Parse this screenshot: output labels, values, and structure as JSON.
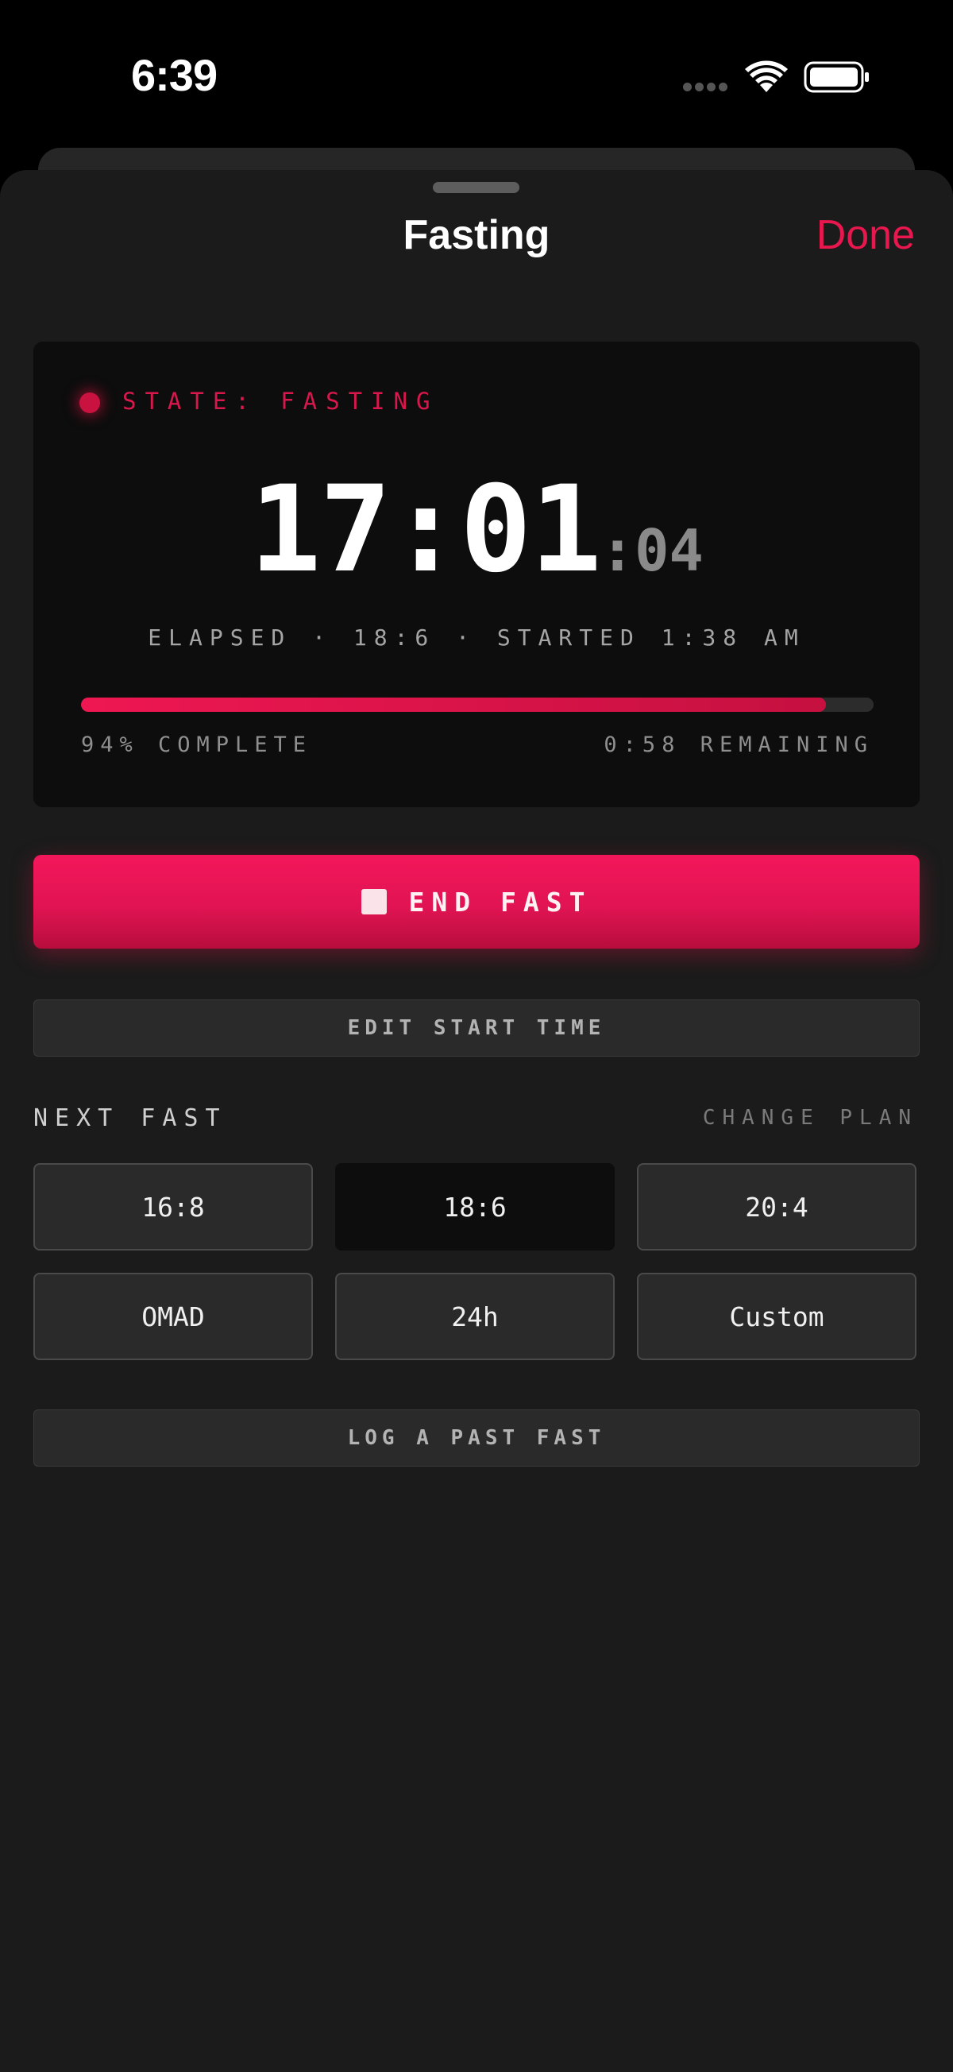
{
  "status_bar": {
    "time": "6:39"
  },
  "sheet": {
    "title": "Fasting",
    "done_label": "Done"
  },
  "timer_card": {
    "state_label": "STATE: FASTING",
    "timer_main": "17:01",
    "timer_seconds": ":04",
    "elapsed_line": "ELAPSED · 18:6 · STARTED 1:38 AM",
    "progress_fraction": 0.94,
    "progress_label": "94% COMPLETE",
    "remaining_label": "0:58 REMAINING"
  },
  "actions": {
    "end_fast_label": "END FAST",
    "edit_start_label": "EDIT START TIME",
    "log_past_label": "LOG A PAST FAST"
  },
  "next_fast": {
    "label": "NEXT FAST",
    "change_plan_label": "CHANGE PLAN",
    "plans": [
      {
        "label": "16:8",
        "selected": false
      },
      {
        "label": "18:6",
        "selected": true
      },
      {
        "label": "20:4",
        "selected": false
      },
      {
        "label": "OMAD",
        "selected": false
      },
      {
        "label": "24h",
        "selected": false
      },
      {
        "label": "Custom",
        "selected": false
      }
    ]
  },
  "colors": {
    "accent": "#e8174e",
    "sheet_background": "#1b1b1b",
    "card_background": "#0d0d0d"
  },
  "icons": [
    "wifi-icon",
    "battery-icon",
    "signal-icon",
    "stop-icon"
  ]
}
